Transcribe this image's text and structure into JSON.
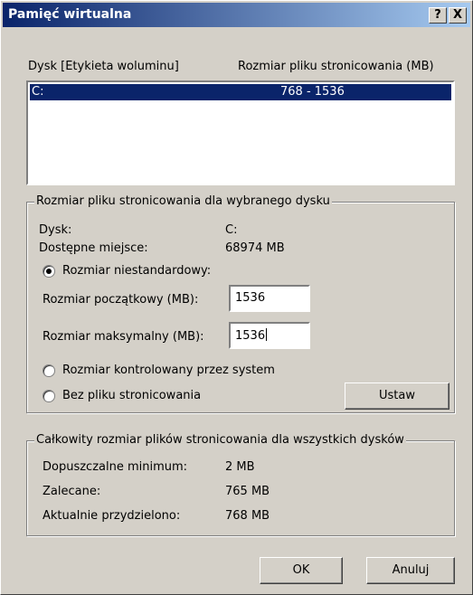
{
  "dialog": {
    "title": "Pamięć wirtualna",
    "help_label": "?",
    "close_label": "X"
  },
  "drive_list": {
    "col_drive": "Dysk [Etykieta woluminu]",
    "col_size": "Rozmiar pliku stronicowania (MB)",
    "rows": [
      {
        "drive": "C:",
        "size": "768 - 1536",
        "selected": true
      }
    ]
  },
  "selected_drive_group": {
    "legend": "Rozmiar pliku stronicowania dla wybranego dysku",
    "drive_label": "Dysk:",
    "drive_value": "C:",
    "space_label": "Dostępne miejsce:",
    "space_value": "68974  MB",
    "custom_size_label": "Rozmiar niestandardowy:",
    "initial_label": "Rozmiar początkowy (MB):",
    "initial_value": "1536",
    "max_label": "Rozmiar maksymalny (MB):",
    "max_value": "1536",
    "system_managed_label": "Rozmiar kontrolowany przez system",
    "no_paging_label": "Bez pliku stronicowania",
    "set_button": "Ustaw",
    "selected_option": "custom"
  },
  "total_group": {
    "legend": "Całkowity rozmiar plików stronicowania dla wszystkich dysków",
    "min_label": "Dopuszczalne minimum:",
    "min_value": "2  MB",
    "recommended_label": "Zalecane:",
    "recommended_value": "765  MB",
    "allocated_label": "Aktualnie przydzielono:",
    "allocated_value": "768  MB"
  },
  "footer": {
    "ok_label": "OK",
    "cancel_label": "Anuluj"
  },
  "colors": {
    "title_start": "#0a246a",
    "title_end": "#a6caf0",
    "selection": "#0a246a",
    "face": "#d4d0c8"
  }
}
